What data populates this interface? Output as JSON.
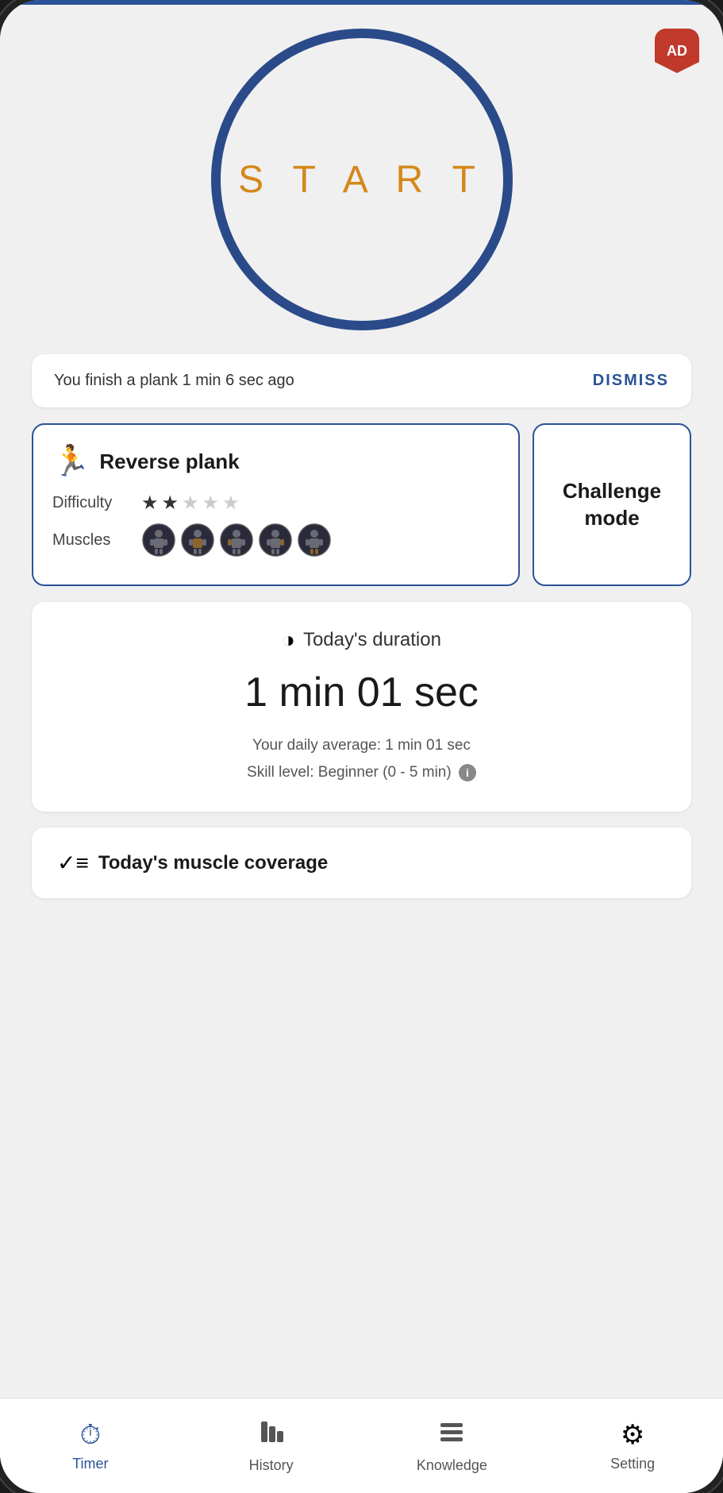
{
  "app": {
    "status_bar_color": "#2a5298"
  },
  "ad_badge": {
    "label": "AD"
  },
  "start_button": {
    "label": "S T A R T"
  },
  "dismiss_card": {
    "message": "You finish a plank 1 min 6 sec ago",
    "button_label": "DISMISS"
  },
  "exercise_card": {
    "name": "Reverse plank",
    "difficulty_label": "Difficulty",
    "muscles_label": "Muscles",
    "stars_filled": 2,
    "stars_total": 5
  },
  "challenge_card": {
    "label": "Challenge mode"
  },
  "duration_card": {
    "title": "Today's duration",
    "value": "1 min 01 sec",
    "daily_average": "Your daily average: 1 min 01 sec",
    "skill_level": "Skill level: Beginner (0 - 5 min)"
  },
  "muscle_coverage_card": {
    "title": "Today's muscle coverage"
  },
  "bottom_nav": {
    "items": [
      {
        "id": "timer",
        "label": "Timer",
        "active": true
      },
      {
        "id": "history",
        "label": "History",
        "active": false
      },
      {
        "id": "knowledge",
        "label": "Knowledge",
        "active": false
      },
      {
        "id": "setting",
        "label": "Setting",
        "active": false
      }
    ]
  }
}
